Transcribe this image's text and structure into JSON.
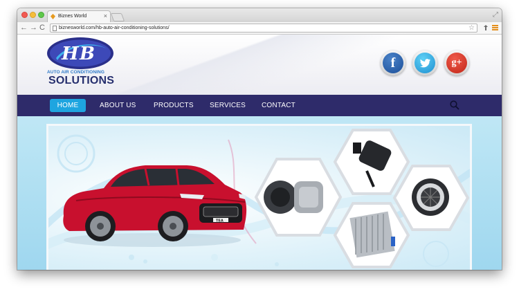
{
  "browser": {
    "tab_title": "Biznes World",
    "tab_close": "×",
    "url": "biznesworld.com/hb-auto-air-conditioning-solutions/",
    "back_glyph": "←",
    "forward_glyph": "→",
    "reload_glyph": "C",
    "star_glyph": "☆",
    "resize_glyph": "⤢"
  },
  "header": {
    "logo_initials": "HB",
    "logo_subtitle": "AUTO AIR CONDITIONING",
    "logo_title": "SOLUTIONS",
    "social": [
      {
        "name": "facebook",
        "glyph": "f"
      },
      {
        "name": "twitter",
        "glyph": ""
      },
      {
        "name": "google-plus",
        "glyph": "g+"
      }
    ]
  },
  "nav": {
    "items": [
      {
        "label": "HOME",
        "active": true
      },
      {
        "label": "ABOUT US"
      },
      {
        "label": "PRODUCTS"
      },
      {
        "label": "SERVICES"
      },
      {
        "label": "CONTACT"
      }
    ]
  },
  "banner": {
    "car_plate": "TEA"
  },
  "colors": {
    "nav_bg": "#2e2b6a",
    "nav_active": "#1ea5e0",
    "logo_navy": "#262f6e",
    "logo_blue": "#2c78c8",
    "car_red": "#c8102e"
  },
  "icons": [
    "favicon-icon",
    "search-icon",
    "facebook-icon",
    "twitter-icon",
    "google-plus-icon",
    "star-icon",
    "menu-icon"
  ]
}
